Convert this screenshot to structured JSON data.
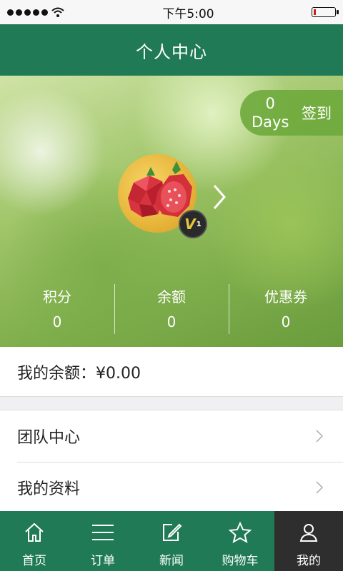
{
  "status_bar": {
    "time": "下午5:00"
  },
  "header": {
    "title": "个人中心"
  },
  "checkin": {
    "days_count": "0",
    "days_unit": "Days",
    "label": "签到"
  },
  "profile": {
    "level_badge": "V",
    "level_num": "1"
  },
  "stats": [
    {
      "label": "积分",
      "value": "0"
    },
    {
      "label": "余额",
      "value": "0"
    },
    {
      "label": "优惠券",
      "value": "0"
    }
  ],
  "balance": {
    "text": "我的余额：¥0.00"
  },
  "menu": [
    {
      "label": "团队中心"
    },
    {
      "label": "我的资料"
    }
  ],
  "tabs": [
    {
      "label": "首页",
      "icon": "home-icon"
    },
    {
      "label": "订单",
      "icon": "list-icon"
    },
    {
      "label": "新闻",
      "icon": "edit-icon"
    },
    {
      "label": "购物车",
      "icon": "star-icon"
    },
    {
      "label": "我的",
      "icon": "user-icon"
    }
  ],
  "colors": {
    "primary": "#1f7a55",
    "active_tab": "#2e2e2e"
  }
}
